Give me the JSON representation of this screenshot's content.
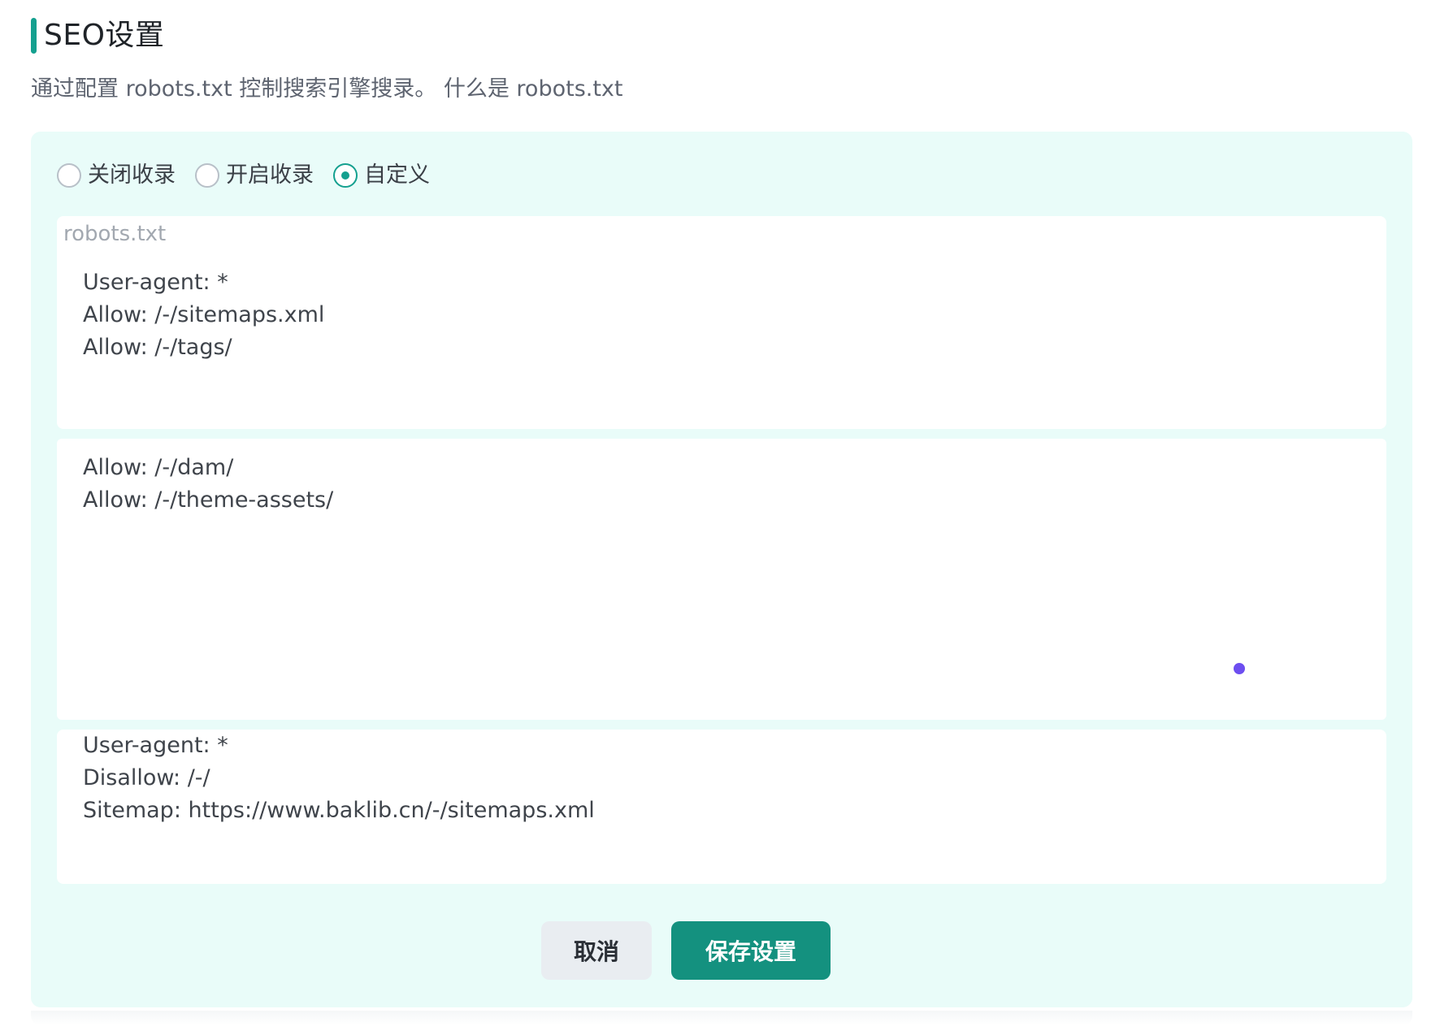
{
  "header": {
    "title": "SEO设置",
    "description_prefix": "通过配置 robots.txt 控制搜索引擎搜录。",
    "link_text": "什么是 robots.txt"
  },
  "radio_group": {
    "options": [
      {
        "label": "关闭收录",
        "checked": false
      },
      {
        "label": "开启收录",
        "checked": false
      },
      {
        "label": "自定义",
        "checked": true
      }
    ]
  },
  "editor": {
    "label": "robots.txt",
    "block1_lines": [
      "User-agent: *",
      "Allow: /-/sitemaps.xml",
      "Allow: /-/tags/"
    ],
    "block2_lines": [
      "Allow: /-/dam/",
      "Allow: /-/theme-assets/"
    ],
    "block3_lines": [
      "User-agent: *",
      "Disallow: /-/",
      "Sitemap: https://www.baklib.cn/-/sitemaps.xml"
    ]
  },
  "actions": {
    "cancel_label": "取消",
    "save_label": "保存设置"
  },
  "colors": {
    "accent": "#14a08f",
    "panel_bg": "#e9fcf9",
    "cursor_dot": "#6d4ef0"
  }
}
